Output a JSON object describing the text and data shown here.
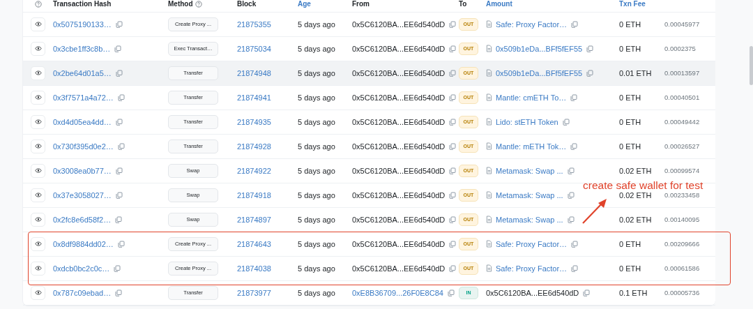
{
  "columns": [
    {
      "label": "Transaction Hash",
      "sortable": false,
      "help": false
    },
    {
      "label": "Method",
      "sortable": false,
      "help": true
    },
    {
      "label": "Block",
      "sortable": false,
      "help": false
    },
    {
      "label": "Age",
      "sortable": true,
      "help": false
    },
    {
      "label": "From",
      "sortable": false,
      "help": false
    },
    {
      "label": "To",
      "sortable": false,
      "help": false
    },
    {
      "label": "Amount",
      "sortable": true,
      "help": false
    },
    {
      "label": "Txn Fee",
      "sortable": true,
      "help": false
    }
  ],
  "rows": [
    {
      "hash": "0x5075190133…",
      "method": "Create Proxy ...",
      "block": "21875355",
      "age": "5 days ago",
      "from": {
        "text": "0x5C6120BA...EE6d540dD",
        "link": false
      },
      "direction": {
        "label": "OUT",
        "kind": "out"
      },
      "to": {
        "text": "Safe: Proxy Factor…",
        "link": true,
        "contract": true
      },
      "amount": "0 ETH",
      "fee": "0.00045977",
      "highlighted": false,
      "boxed": false
    },
    {
      "hash": "0x3cbe1ff3c8b…",
      "method": "Exec Transact…",
      "block": "21875034",
      "age": "5 days ago",
      "from": {
        "text": "0x5C6120BA...EE6d540dD",
        "link": false
      },
      "direction": {
        "label": "OUT",
        "kind": "out"
      },
      "to": {
        "text": "0x509b1eDa...BFf5fEF55",
        "link": true,
        "contract": true
      },
      "amount": "0 ETH",
      "fee": "0.0002375",
      "highlighted": false,
      "boxed": false
    },
    {
      "hash": "0x2be64d01a5…",
      "method": "Transfer",
      "block": "21874948",
      "age": "5 days ago",
      "from": {
        "text": "0x5C6120BA...EE6d540dD",
        "link": false
      },
      "direction": {
        "label": "OUT",
        "kind": "out"
      },
      "to": {
        "text": "0x509b1eDa...BFf5fEF55",
        "link": true,
        "contract": true
      },
      "amount": "0.01 ETH",
      "fee": "0.00013597",
      "highlighted": true,
      "boxed": false
    },
    {
      "hash": "0x3f7571a4a72…",
      "method": "Transfer",
      "block": "21874941",
      "age": "5 days ago",
      "from": {
        "text": "0x5C6120BA...EE6d540dD",
        "link": false
      },
      "direction": {
        "label": "OUT",
        "kind": "out"
      },
      "to": {
        "text": "Mantle: cmETH To…",
        "link": true,
        "contract": true
      },
      "amount": "0 ETH",
      "fee": "0.00040501",
      "highlighted": false,
      "boxed": false
    },
    {
      "hash": "0xd4d05ea4dd…",
      "method": "Transfer",
      "block": "21874935",
      "age": "5 days ago",
      "from": {
        "text": "0x5C6120BA...EE6d540dD",
        "link": false
      },
      "direction": {
        "label": "OUT",
        "kind": "out"
      },
      "to": {
        "text": "Lido: stETH Token",
        "link": true,
        "contract": true
      },
      "amount": "0 ETH",
      "fee": "0.00049442",
      "highlighted": false,
      "boxed": false
    },
    {
      "hash": "0x730f395d0e2…",
      "method": "Transfer",
      "block": "21874928",
      "age": "5 days ago",
      "from": {
        "text": "0x5C6120BA...EE6d540dD",
        "link": false
      },
      "direction": {
        "label": "OUT",
        "kind": "out"
      },
      "to": {
        "text": "Mantle: mETH Tok…",
        "link": true,
        "contract": true
      },
      "amount": "0 ETH",
      "fee": "0.00026527",
      "highlighted": false,
      "boxed": false
    },
    {
      "hash": "0x3008ea0b77…",
      "method": "Swap",
      "block": "21874922",
      "age": "5 days ago",
      "from": {
        "text": "0x5C6120BA...EE6d540dD",
        "link": false
      },
      "direction": {
        "label": "OUT",
        "kind": "out"
      },
      "to": {
        "text": "Metamask: Swap ...",
        "link": true,
        "contract": true
      },
      "amount": "0.02 ETH",
      "fee": "0.00099574",
      "highlighted": false,
      "boxed": false
    },
    {
      "hash": "0x37e3058027…",
      "method": "Swap",
      "block": "21874918",
      "age": "5 days ago",
      "from": {
        "text": "0x5C6120BA...EE6d540dD",
        "link": false
      },
      "direction": {
        "label": "OUT",
        "kind": "out"
      },
      "to": {
        "text": "Metamask: Swap ...",
        "link": true,
        "contract": true
      },
      "amount": "0.02 ETH",
      "fee": "0.00233458",
      "highlighted": false,
      "boxed": false
    },
    {
      "hash": "0x2fc8e6d58f2…",
      "method": "Swap",
      "block": "21874897",
      "age": "5 days ago",
      "from": {
        "text": "0x5C6120BA...EE6d540dD",
        "link": false
      },
      "direction": {
        "label": "OUT",
        "kind": "out"
      },
      "to": {
        "text": "Metamask: Swap ...",
        "link": true,
        "contract": true
      },
      "amount": "0.02 ETH",
      "fee": "0.00140095",
      "highlighted": false,
      "boxed": false
    },
    {
      "hash": "0x8df9884dd02…",
      "method": "Create Proxy ...",
      "block": "21874643",
      "age": "5 days ago",
      "from": {
        "text": "0x5C6120BA...EE6d540dD",
        "link": false
      },
      "direction": {
        "label": "OUT",
        "kind": "out"
      },
      "to": {
        "text": "Safe: Proxy Factor…",
        "link": true,
        "contract": true
      },
      "amount": "0 ETH",
      "fee": "0.00209666",
      "highlighted": false,
      "boxed": true
    },
    {
      "hash": "0xdcb0bc2c0c…",
      "method": "Create Proxy ...",
      "block": "21874038",
      "age": "5 days ago",
      "from": {
        "text": "0x5C6120BA...EE6d540dD",
        "link": false
      },
      "direction": {
        "label": "OUT",
        "kind": "out"
      },
      "to": {
        "text": "Safe: Proxy Factor…",
        "link": true,
        "contract": true
      },
      "amount": "0 ETH",
      "fee": "0.00061586",
      "highlighted": false,
      "boxed": true
    },
    {
      "hash": "0x787c09ebad…",
      "method": "Transfer",
      "block": "21873977",
      "age": "5 days ago",
      "from": {
        "text": "0xE8B36709...26F0E8C84",
        "link": true
      },
      "direction": {
        "label": "IN",
        "kind": "in"
      },
      "to": {
        "text": "0x5C6120BA...EE6d540dD",
        "link": false,
        "contract": false
      },
      "amount": "0.1 ETH",
      "fee": "0.00005736",
      "highlighted": false,
      "boxed": false
    }
  ],
  "annotation": {
    "text": "create safe wallet for test"
  }
}
